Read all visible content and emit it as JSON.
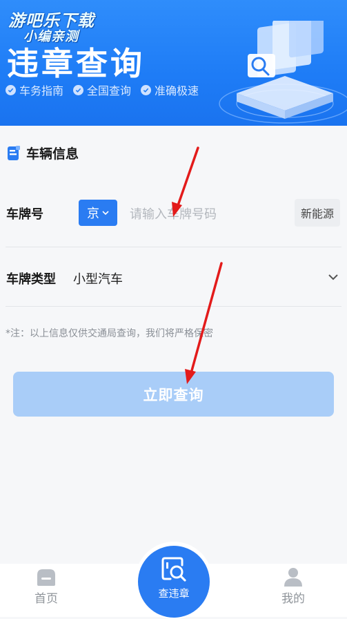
{
  "banner": {
    "watermark_line1": "游吧乐下载",
    "watermark_line2": "小编亲测",
    "title": "违章查询",
    "features": [
      "车务指南",
      "全国查询",
      "准确极速"
    ]
  },
  "section": {
    "title": "车辆信息"
  },
  "plate": {
    "label": "车牌号",
    "province": "京",
    "placeholder": "请输入车牌号码",
    "new_energy_label": "新能源"
  },
  "plate_type": {
    "label": "车牌类型",
    "value": "小型汽车"
  },
  "note": "*注：以上信息仅供交通局查询，我们将严格保密",
  "submit_label": "立即查询",
  "tabs": {
    "home": "首页",
    "center": "查违章",
    "mine": "我的"
  },
  "colors": {
    "primary": "#2a7cf2",
    "button_disabled": "#a9cdf8",
    "arrow": "#e31b1b"
  },
  "icons": {
    "home": "home-icon",
    "center": "search-document-icon",
    "mine": "user-icon",
    "section": "document-icon",
    "chevron": "chevron-down-icon"
  }
}
